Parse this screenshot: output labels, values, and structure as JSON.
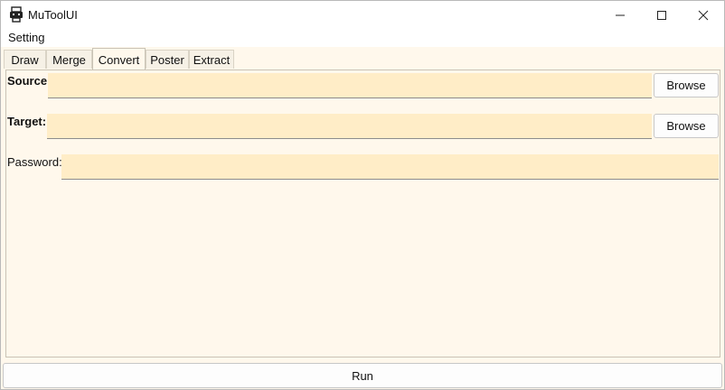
{
  "window": {
    "title": "MuToolUI",
    "icon": "printer-robot-icon",
    "controls": [
      "minimize-icon",
      "maximize-icon",
      "close-icon"
    ]
  },
  "menu": {
    "items": [
      "Setting"
    ]
  },
  "tabs": [
    {
      "label": "Draw",
      "active": false
    },
    {
      "label": "Merge",
      "active": false
    },
    {
      "label": "Convert",
      "active": true
    },
    {
      "label": "Poster",
      "active": false
    },
    {
      "label": "Extract",
      "active": false
    }
  ],
  "form": {
    "source_label": "Source:",
    "source_value": "",
    "target_label": "Target:",
    "target_value": "",
    "password_label": "Password:",
    "password_value": "",
    "browse_label": "Browse"
  },
  "run_label": "Run",
  "colors": {
    "panel_background": "#fff8ec",
    "input_background": "#ffedc7"
  }
}
